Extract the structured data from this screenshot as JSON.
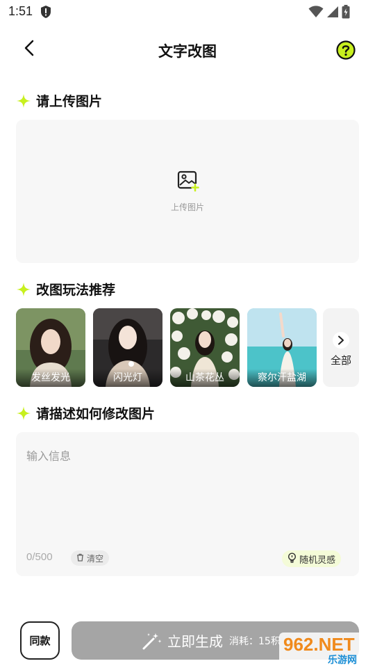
{
  "status_bar": {
    "time": "1:51"
  },
  "header": {
    "title": "文字改图"
  },
  "upload_section": {
    "title": "请上传图片",
    "upload_label": "上传图片"
  },
  "recommend_section": {
    "title": "改图玩法推荐",
    "items": [
      {
        "label": "发丝发光"
      },
      {
        "label": "闪光灯"
      },
      {
        "label": "山茶花丛"
      },
      {
        "label": "察尔汗盐湖"
      }
    ],
    "all_label": "全部"
  },
  "describe_section": {
    "title": "请描述如何修改图片",
    "placeholder": "输入信息",
    "char_count": "0/500",
    "clear_label": "清空",
    "inspire_label": "随机灵感"
  },
  "bottom": {
    "same_label": "同款",
    "generate_label": "立即生成",
    "cost_label": "消耗：15积"
  },
  "watermark": {
    "brand": "962.NET",
    "sub": "乐游网"
  },
  "colors": {
    "accent": "#c8f01e",
    "button_gray": "#a5a5a5"
  }
}
